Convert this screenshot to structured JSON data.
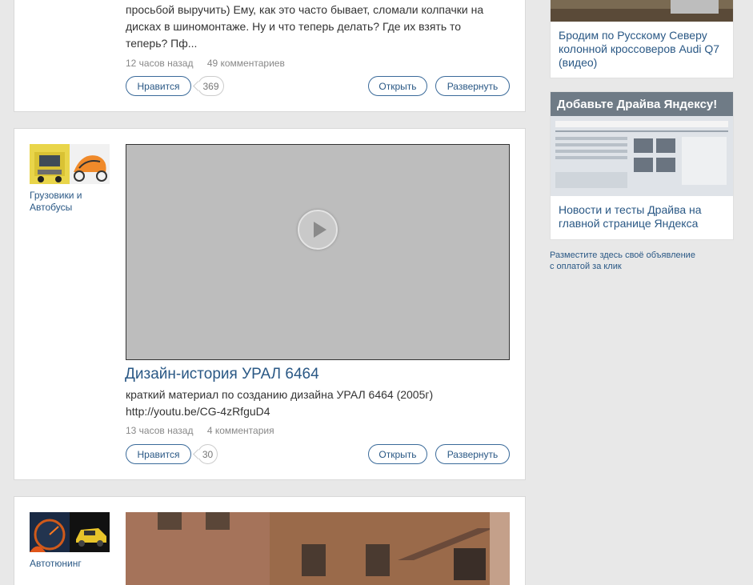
{
  "post1": {
    "text": "просьбой выручить) Ему, как это часто бывает, сломали колпачки на дисках в шиномонтаже. Ну и что теперь делать? Где их взять то теперь? Пф...",
    "time": "12 часов назад",
    "comments": "49 комментариев",
    "like_label": "Нравится",
    "like_count": "369",
    "open_label": "Открыть",
    "expand_label": "Развернуть"
  },
  "post2": {
    "category": "Грузовики и Автобусы",
    "title": "Дизайн-история УРАЛ 6464",
    "text_line1": "краткий материал по созданию дизайна УРАЛ 6464 (2005г)",
    "text_line2": "http://youtu.be/CG-4zRfguD4",
    "time": "13 часов назад",
    "comments": "4 комментария",
    "like_label": "Нравится",
    "like_count": "30",
    "open_label": "Открыть",
    "expand_label": "Развернуть"
  },
  "post3": {
    "category": "Автотюнинг"
  },
  "sidebar": {
    "ad1_title": "Бродим по Русскому Северу колонной кроссоверов Audi Q7 (видео)",
    "ad2_banner": "Добавьте Драйва Яндексу!",
    "ad2_title": "Новости и тесты Драйва на главной странице Яндекса",
    "place_ad_line1": "Разместите здесь своё объявление",
    "place_ad_line2": "с оплатой за клик"
  }
}
